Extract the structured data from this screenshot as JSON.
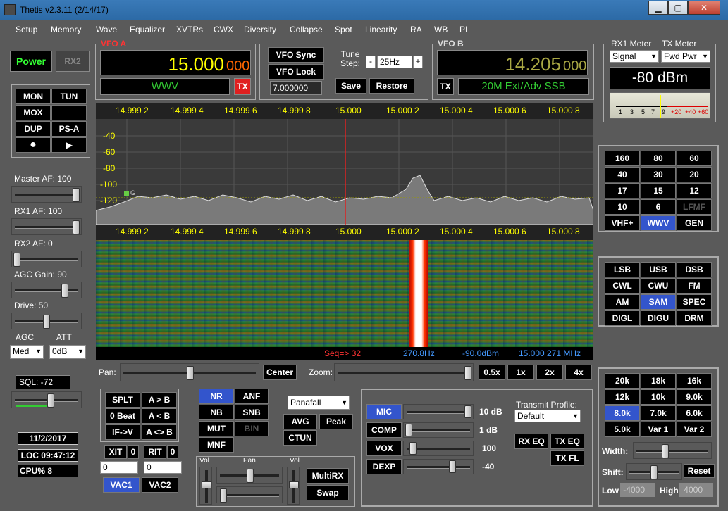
{
  "window": {
    "title": "Thetis v2.3.11 (2/14/17)",
    "min": "▁",
    "max": "▢",
    "close": "✕"
  },
  "menu": [
    "Setup",
    "Memory",
    "Wave",
    "Equalizer",
    "XVTRs",
    "CWX",
    "Diversity",
    "Collapse",
    "Spot",
    "Linearity",
    "RA",
    "WB",
    "PI"
  ],
  "power": {
    "label": "Power",
    "rx2": "RX2"
  },
  "modes": {
    "mon": "MON",
    "tun": "TUN",
    "mox": "MOX",
    "dup": "DUP",
    "psa": "PS-A",
    "rec": "●",
    "play": "▶"
  },
  "vfoa": {
    "label": "VFO A",
    "freq_main": "15.000",
    "freq_sub": "000",
    "band": "WWV",
    "tx": "TX"
  },
  "vfoctrl": {
    "sync": "VFO Sync",
    "lock": "VFO Lock",
    "tune_label": "Tune\nStep:",
    "tune_label1": "Tune",
    "tune_label2": "Step:",
    "minus": "-",
    "plus": "+",
    "step": "25Hz",
    "freq": "7.000000",
    "save": "Save",
    "restore": "Restore"
  },
  "vfob": {
    "label": "VFO B",
    "freq_main": "14.205",
    "freq_sub": "000",
    "tx": "TX",
    "band": "20M Ext/Adv SSB"
  },
  "meter": {
    "rx1_label": "RX1 Meter",
    "tx_label": "TX Meter",
    "rx_select": "Signal",
    "tx_select": "Fwd Pwr",
    "reading": "-80 dBm",
    "scale": [
      "1",
      "3",
      "5",
      "7",
      "9",
      "+20",
      "+40",
      "+60"
    ]
  },
  "panadapter": {
    "freqs": [
      "14.999 2",
      "14.999 4",
      "14.999 6",
      "14.999 8",
      "15.000",
      "15.000 2",
      "15.000 4",
      "15.000 6",
      "15.000 8"
    ],
    "db": [
      "-40",
      "-60",
      "-80",
      "-100",
      "-120"
    ],
    "marker": "G"
  },
  "status": {
    "seq": "Seq=> 32",
    "hz": "270.8Hz",
    "dbm": "-90.0dBm",
    "mhz": "15.000 271 MHz"
  },
  "left": {
    "master_af": "Master AF:  100",
    "rx1_af": "RX1 AF:  100",
    "rx2_af": "RX2 AF:  0",
    "agc_gain": "AGC Gain:  90",
    "drive": "Drive:  50",
    "agc": "AGC",
    "att": "ATT",
    "agc_val": "Med",
    "att_val": "0dB",
    "sql": "SQL:  -72"
  },
  "bands": [
    "160",
    "80",
    "60",
    "40",
    "30",
    "20",
    "17",
    "15",
    "12",
    "10",
    "6",
    "LFMF",
    "VHF+",
    "WWV",
    "GEN"
  ],
  "modelist": [
    "LSB",
    "USB",
    "DSB",
    "CWL",
    "CWU",
    "FM",
    "AM",
    "SAM",
    "SPEC",
    "DIGL",
    "DIGU",
    "DRM"
  ],
  "filters": [
    "20k",
    "18k",
    "16k",
    "12k",
    "10k",
    "9.0k",
    "8.0k",
    "7.0k",
    "6.0k",
    "5.0k",
    "Var 1",
    "Var 2"
  ],
  "filterctrl": {
    "width": "Width:",
    "shift": "Shift:",
    "reset": "Reset",
    "low": "Low",
    "high": "High",
    "low_val": "-4000",
    "high_val": "4000"
  },
  "pan": {
    "pan": "Pan:",
    "center": "Center",
    "zoom": "Zoom:",
    "z05": "0.5x",
    "z1": "1x",
    "z2": "2x",
    "z4": "4x"
  },
  "rit": {
    "splt": "SPLT",
    "a_b": "A > B",
    "beat": "0 Beat",
    "b_a": "A < B",
    "ifv": "IF->V",
    "swap": "A <> B",
    "xit": "XIT",
    "xit_v": "0",
    "rit": "RIT",
    "rit_v": "0",
    "xit_n": "0",
    "rit_n": "0",
    "vac1": "VAC1",
    "vac2": "VAC2"
  },
  "dsp": {
    "nr": "NR",
    "anf": "ANF",
    "nb": "NB",
    "snb": "SNB",
    "mut": "MUT",
    "bin": "BIN",
    "mnf": "MNF",
    "display": "Panafall",
    "avg": "AVG",
    "peak": "Peak",
    "ctun": "CTUN",
    "multirx": "MultiRX",
    "swap": "Swap",
    "vol": "Vol",
    "pan": "Pan",
    "vol2": "Vol"
  },
  "tx": {
    "mic": "MIC",
    "mic_v": "10 dB",
    "comp": "COMP",
    "comp_v": "1 dB",
    "vox": "VOX",
    "vox_v": "100",
    "dexp": "DEXP",
    "dexp_v": "-40",
    "profile_label": "Transmit Profile:",
    "profile": "Default",
    "rxeq": "RX EQ",
    "txeq": "TX EQ",
    "txfl": "TX FL"
  },
  "info": {
    "date": "11/2/2017",
    "loc": "LOC 09:47:12",
    "cpu": "CPU%  8"
  }
}
